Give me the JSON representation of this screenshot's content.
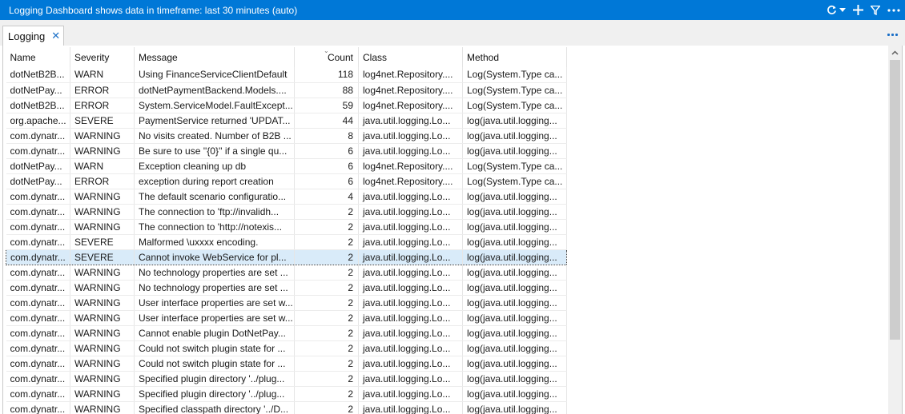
{
  "titlebar": {
    "title": "Logging Dashboard shows data in timeframe: last 30 minutes (auto)",
    "icons": [
      "refresh-icon",
      "chevron-down-icon",
      "plus-icon",
      "filter-icon",
      "more-icon"
    ]
  },
  "tab": {
    "label": "Logging",
    "close_glyph": "✕"
  },
  "table": {
    "columns": [
      {
        "key": "name",
        "label": "Name"
      },
      {
        "key": "severity",
        "label": "Severity"
      },
      {
        "key": "message",
        "label": "Message"
      },
      {
        "key": "count",
        "label": "Count",
        "sorted": "descending"
      },
      {
        "key": "class",
        "label": "Class"
      },
      {
        "key": "method",
        "label": "Method"
      }
    ],
    "selected_row_index": 12,
    "rows": [
      [
        "dotNetB2B...",
        "WARN",
        "Using FinanceServiceClientDefault",
        "118",
        "log4net.Repository....",
        "Log(System.Type ca..."
      ],
      [
        "dotNetPay...",
        "ERROR",
        "dotNetPaymentBackend.Models....",
        "88",
        "log4net.Repository....",
        "Log(System.Type ca..."
      ],
      [
        "dotNetB2B...",
        "ERROR",
        "System.ServiceModel.FaultExcept...",
        "59",
        "log4net.Repository....",
        "Log(System.Type ca..."
      ],
      [
        "org.apache...",
        "SEVERE",
        "PaymentService returned 'UPDAT...",
        "44",
        "java.util.logging.Lo...",
        "log(java.util.logging..."
      ],
      [
        "com.dynatr...",
        "WARNING",
        "No visits created. Number of B2B ...",
        "8",
        "java.util.logging.Lo...",
        "log(java.util.logging..."
      ],
      [
        "com.dynatr...",
        "WARNING",
        "Be sure to use ''{0}'' if a single qu...",
        "6",
        "java.util.logging.Lo...",
        "log(java.util.logging..."
      ],
      [
        "dotNetPay...",
        "WARN",
        "Exception cleaning up db",
        "6",
        "log4net.Repository....",
        "Log(System.Type ca..."
      ],
      [
        "dotNetPay...",
        "ERROR",
        "exception during report creation",
        "6",
        "log4net.Repository....",
        "Log(System.Type ca..."
      ],
      [
        "com.dynatr...",
        "WARNING",
        "The default scenario configuratio...",
        "4",
        "java.util.logging.Lo...",
        "log(java.util.logging..."
      ],
      [
        "com.dynatr...",
        "WARNING",
        "The connection to 'ftp://invalidh...",
        "2",
        "java.util.logging.Lo...",
        "log(java.util.logging..."
      ],
      [
        "com.dynatr...",
        "WARNING",
        "The connection to 'http://notexis...",
        "2",
        "java.util.logging.Lo...",
        "log(java.util.logging..."
      ],
      [
        "com.dynatr...",
        "SEVERE",
        "Malformed \\uxxxx encoding.",
        "2",
        "java.util.logging.Lo...",
        "log(java.util.logging..."
      ],
      [
        "com.dynatr...",
        "SEVERE",
        "Cannot invoke WebService for pl...",
        "2",
        "java.util.logging.Lo...",
        "log(java.util.logging..."
      ],
      [
        "com.dynatr...",
        "WARNING",
        "No technology properties are set ...",
        "2",
        "java.util.logging.Lo...",
        "log(java.util.logging..."
      ],
      [
        "com.dynatr...",
        "WARNING",
        "No technology properties are set ...",
        "2",
        "java.util.logging.Lo...",
        "log(java.util.logging..."
      ],
      [
        "com.dynatr...",
        "WARNING",
        "User interface properties are set w...",
        "2",
        "java.util.logging.Lo...",
        "log(java.util.logging..."
      ],
      [
        "com.dynatr...",
        "WARNING",
        "User interface properties are set w...",
        "2",
        "java.util.logging.Lo...",
        "log(java.util.logging..."
      ],
      [
        "com.dynatr...",
        "WARNING",
        "Cannot enable plugin DotNetPay...",
        "2",
        "java.util.logging.Lo...",
        "log(java.util.logging..."
      ],
      [
        "com.dynatr...",
        "WARNING",
        "Could not switch plugin state for ...",
        "2",
        "java.util.logging.Lo...",
        "log(java.util.logging..."
      ],
      [
        "com.dynatr...",
        "WARNING",
        "Could not switch plugin state for ...",
        "2",
        "java.util.logging.Lo...",
        "log(java.util.logging..."
      ],
      [
        "com.dynatr...",
        "WARNING",
        "Specified plugin directory '../plug...",
        "2",
        "java.util.logging.Lo...",
        "log(java.util.logging..."
      ],
      [
        "com.dynatr...",
        "WARNING",
        "Specified plugin directory '../plug...",
        "2",
        "java.util.logging.Lo...",
        "log(java.util.logging..."
      ],
      [
        "com.dynatr...",
        "WARNING",
        "Specified classpath directory '../D...",
        "2",
        "java.util.logging.Lo...",
        "log(java.util.logging..."
      ]
    ]
  },
  "colors": {
    "titlebar": "#0078d7",
    "selection": "#d9ebf9",
    "accent": "#1a6fc7"
  }
}
